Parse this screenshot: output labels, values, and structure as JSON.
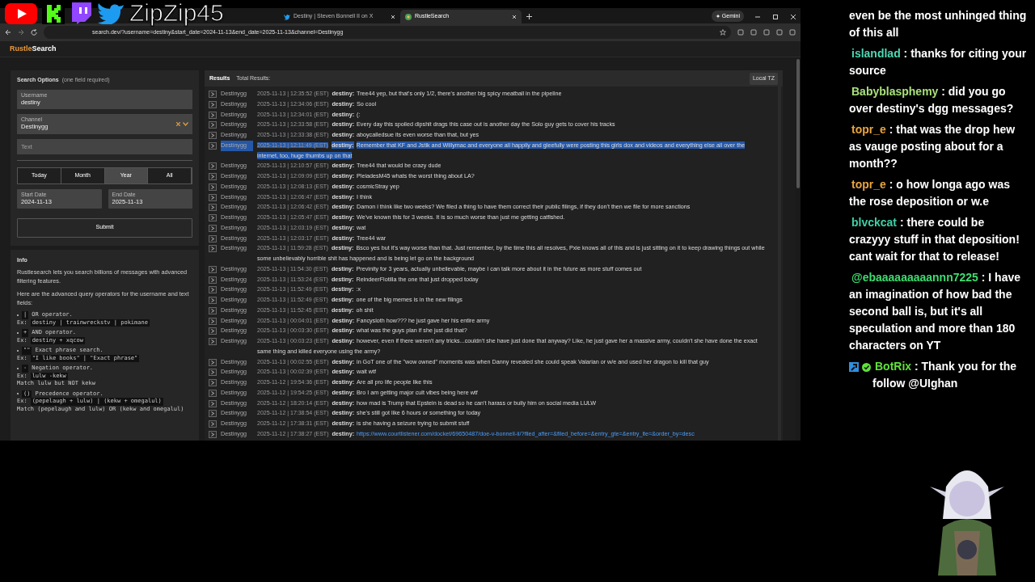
{
  "overlay": {
    "channel_name": "ZipZip45"
  },
  "browser": {
    "tabs": [
      {
        "title": "Destiny | Steven Bonnell II on X",
        "selected": false,
        "kind": "x"
      },
      {
        "title": "RustleSearch",
        "selected": true,
        "kind": "site"
      }
    ],
    "gemini_label": "Gemini",
    "url": "search.dev/?username=destiny&start_date=2024-11-13&end_date=2025-11-13&channel=Destinygg"
  },
  "site": {
    "logo_accent": "Rustle",
    "logo_rest": "Search"
  },
  "search_options": {
    "title": "Search Options",
    "hint": "(one field required)",
    "username": {
      "label": "Username",
      "value": "destiny"
    },
    "channel": {
      "label": "Channel",
      "value": "Destinygg"
    },
    "text": {
      "placeholder": "Text"
    },
    "ranges": [
      {
        "label": "Today",
        "selected": false
      },
      {
        "label": "Month",
        "selected": false
      },
      {
        "label": "Year",
        "selected": true
      },
      {
        "label": "All",
        "selected": false
      }
    ],
    "start_date": {
      "label": "Start Date",
      "value": "2024-11-13"
    },
    "end_date": {
      "label": "End Date",
      "value": "2025-11-13"
    },
    "submit": "Submit"
  },
  "info": {
    "title": "Info",
    "paragraphs": [
      "Rustlesearch lets you search billions of messages with advanced filtering features.",
      "Here are the advanced query operators for the username and text fields:"
    ],
    "operators": [
      {
        "op": "|",
        "desc": "OR operator.",
        "ex_label": "Ex:",
        "example": "destiny | trainwreckstv | pokimane"
      },
      {
        "op": "+",
        "desc": "AND operator.",
        "ex_label": "Ex:",
        "example": "destiny + xqcow"
      },
      {
        "op": "\"\"",
        "desc": "Exact phrase search.",
        "ex_label": "Ex:",
        "example": "\"I like books\" | \"Exact phrase\""
      },
      {
        "op": "-",
        "desc": "Negation operator.",
        "ex_label": "Ex:",
        "example": "lulw -kekw",
        "note": "Match lulw but NOT kekw"
      },
      {
        "op": "()",
        "desc": "Precedence operator.",
        "ex_label": "Ex:",
        "example": "(pepelaugh + lulw) | (kekw + omegalul)",
        "note": "Match (pepelaugh and lulw) OR (kekw and omegalul)"
      }
    ]
  },
  "results": {
    "title": "Results",
    "total_label": "Total Results:",
    "tz_button": "Local TZ",
    "rows": [
      {
        "channel": "Destinygg",
        "time": "2025-11-13 | 12:35:52 (EST)",
        "user": "destiny:",
        "message": "Tree44 yep, but that's only 1/2, there's another big spicy meatball in the pipeline",
        "kind": "text",
        "highlighted": false
      },
      {
        "channel": "Destinygg",
        "time": "2025-11-13 | 12:34:06 (EST)",
        "user": "destiny:",
        "message": "So cool",
        "kind": "text",
        "highlighted": false
      },
      {
        "channel": "Destinygg",
        "time": "2025-11-13 | 12:34:01 (EST)",
        "user": "destiny:",
        "message": "(:",
        "kind": "text",
        "highlighted": false
      },
      {
        "channel": "Destinygg",
        "time": "2025-11-13 | 12:33:58 (EST)",
        "user": "destiny:",
        "message": "Every day this spoiled dipshit drags this case out is another day the Solo guy gets to cover his tracks",
        "kind": "text",
        "highlighted": false
      },
      {
        "channel": "Destinygg",
        "time": "2025-11-13 | 12:33:38 (EST)",
        "user": "destiny:",
        "message": "aboycalledsue its even worse than that, but yes",
        "kind": "text",
        "highlighted": false
      },
      {
        "channel": "Destinygg",
        "time": "2025-11-13 | 12:11:49 (EST)",
        "user": "destiny:",
        "message": "Remember that KF and Jstik and Willymac and everyone all happily and gleefully were posting this girls dox and videos and everything else all over the internet, too, huge thumbs up on that",
        "kind": "text",
        "highlighted": true
      },
      {
        "channel": "Destinygg",
        "time": "2025-11-13 | 12:10:57 (EST)",
        "user": "destiny:",
        "message": "Tree44 that would be crazy dude",
        "kind": "text",
        "highlighted": false
      },
      {
        "channel": "Destinygg",
        "time": "2025-11-13 | 12:09:09 (EST)",
        "user": "destiny:",
        "message": "PleiadesM45 whats the worst thing about LA?",
        "kind": "text",
        "highlighted": false
      },
      {
        "channel": "Destinygg",
        "time": "2025-11-13 | 12:08:13 (EST)",
        "user": "destiny:",
        "message": "cosmicStray yep",
        "kind": "text",
        "highlighted": false
      },
      {
        "channel": "Destinygg",
        "time": "2025-11-13 | 12:06:47 (EST)",
        "user": "destiny:",
        "message": "I think",
        "kind": "text",
        "highlighted": false
      },
      {
        "channel": "Destinygg",
        "time": "2025-11-13 | 12:06:42 (EST)",
        "user": "destiny:",
        "message": "Damon i think like two weeks? We filed a thing to have them correct their public filings, if they don't then we file for more sanctions",
        "kind": "text",
        "highlighted": false
      },
      {
        "channel": "Destinygg",
        "time": "2025-11-13 | 12:05:47 (EST)",
        "user": "destiny:",
        "message": "We've known this for 3 weeks. It is so much worse than just me getting catfished.",
        "kind": "text",
        "highlighted": false
      },
      {
        "channel": "Destinygg",
        "time": "2025-11-13 | 12:03:19 (EST)",
        "user": "destiny:",
        "message": "wat",
        "kind": "text",
        "highlighted": false
      },
      {
        "channel": "Destinygg",
        "time": "2025-11-13 | 12:03:17 (EST)",
        "user": "destiny:",
        "message": "Tree44 war",
        "kind": "text",
        "highlighted": false
      },
      {
        "channel": "Destinygg",
        "time": "2025-11-13 | 11:59:28 (EST)",
        "user": "destiny:",
        "message": "Bsco yes but it's way worse than that. Just remember, by the time this all resolves, Pxie knows all of this and is just sitting on it to keep drawing things out while some unbelievably horrible shit has happened and is being let go on the background",
        "kind": "text",
        "highlighted": false
      },
      {
        "channel": "Destinygg",
        "time": "2025-11-13 | 11:54:30 (EST)",
        "user": "destiny:",
        "message": "Previnity for 3 years, actually unbelievable, maybe I can talk more about it in the future as more stuff comes out",
        "kind": "text",
        "highlighted": false
      },
      {
        "channel": "Destinygg",
        "time": "2025-11-13 | 11:53:24 (EST)",
        "user": "destiny:",
        "message": "ReindeerFlotilla the one that just dropped today",
        "kind": "text",
        "highlighted": false
      },
      {
        "channel": "Destinygg",
        "time": "2025-11-13 | 11:52:49 (EST)",
        "user": "destiny:",
        "message": ":x",
        "kind": "text",
        "highlighted": false
      },
      {
        "channel": "Destinygg",
        "time": "2025-11-13 | 11:52:49 (EST)",
        "user": "destiny:",
        "message": "one of the big memes is in the new filings",
        "kind": "text",
        "highlighted": false
      },
      {
        "channel": "Destinygg",
        "time": "2025-11-13 | 11:52:45 (EST)",
        "user": "destiny:",
        "message": "oh shit",
        "kind": "text",
        "highlighted": false
      },
      {
        "channel": "Destinygg",
        "time": "2025-11-13 | 00:04:01 (EST)",
        "user": "destiny:",
        "message": "Fancysloth how??? he just gave her his entire army",
        "kind": "text",
        "highlighted": false
      },
      {
        "channel": "Destinygg",
        "time": "2025-11-13 | 00:03:30 (EST)",
        "user": "destiny:",
        "message": "what was the guys plan if she just did that?",
        "kind": "text",
        "highlighted": false
      },
      {
        "channel": "Destinygg",
        "time": "2025-11-13 | 00:03:23 (EST)",
        "user": "destiny:",
        "message": "however, even if there weren't any tricks...couldn't she have just done that anyway? Like, he just gave her a massive army, couldn't she have done the exact same thing and killed everyone using the army?",
        "kind": "text",
        "highlighted": false
      },
      {
        "channel": "Destinygg",
        "time": "2025-11-13 | 00:02:55 (EST)",
        "user": "destiny:",
        "message": "in GoT one of the \"wow owned\" moments was when Danny revealed she could speak Valarian or w/e and used her dragon to kill that guy",
        "kind": "text",
        "highlighted": false
      },
      {
        "channel": "Destinygg",
        "time": "2025-11-13 | 00:02:39 (EST)",
        "user": "destiny:",
        "message": "wait wtf",
        "kind": "text",
        "highlighted": false
      },
      {
        "channel": "Destinygg",
        "time": "2025-11-12 | 19:54:36 (EST)",
        "user": "destiny:",
        "message": "Are all pro life people like this",
        "kind": "text",
        "highlighted": false
      },
      {
        "channel": "Destinygg",
        "time": "2025-11-12 | 19:54:25 (EST)",
        "user": "destiny:",
        "message": "Bro I am getting major cult vibes being here wtf",
        "kind": "text",
        "highlighted": false
      },
      {
        "channel": "Destinygg",
        "time": "2025-11-12 | 18:20:14 (EST)",
        "user": "destiny:",
        "message": "how mad is Trump that Epstein is dead so he can't harass or bully him on social media LULW",
        "kind": "text",
        "highlighted": false
      },
      {
        "channel": "Destinygg",
        "time": "2025-11-12 | 17:38:54 (EST)",
        "user": "destiny:",
        "message": "she's still got like 6 hours or something for today",
        "kind": "text",
        "highlighted": false
      },
      {
        "channel": "Destinygg",
        "time": "2025-11-12 | 17:38:31 (EST)",
        "user": "destiny:",
        "message": "is she having a seizure trying to submit stuff",
        "kind": "text",
        "highlighted": false
      },
      {
        "channel": "Destinygg",
        "time": "2025-11-12 | 17:38:27 (EST)",
        "user": "destiny:",
        "message": "https://www.courtlistener.com/docket/69650487/doe-v-bonnell-ii/?filed_after=&filed_before=&entry_gte=&entry_lte=&order_by=desc",
        "kind": "link",
        "highlighted": false
      }
    ]
  },
  "chat": [
    {
      "text": "even be the most unhinged thing of this all"
    },
    {
      "user": "islandlad",
      "color": "#4fd6b4",
      "text": ": thanks for citing your source"
    },
    {
      "user": "Babyblasphemy",
      "color": "#a8e07a",
      "text": ": did you go over destiny's dgg messages?"
    },
    {
      "user": "topr_e",
      "color": "#e8a340",
      "text": ": that was the drop hew as vauge posting about for a month??"
    },
    {
      "user": "topr_e",
      "color": "#e8a340",
      "text": ": o how longa ago was the rose deposition or w.e"
    },
    {
      "user": "blvckcat",
      "color": "#3fcfa4",
      "text": ": there could be crazyyy stuff in that deposition! cant wait for that to release!"
    },
    {
      "user": "@ebaaaaaaaaannn7225",
      "color": "#3ddc70",
      "text": ": I have an imagination of how bad the second ball is, but it's all speculation and more than 180 characters on YT"
    },
    {
      "user": "BotRix",
      "color": "#5fe03a",
      "text": ": Thank you for the follow @UIghan",
      "badges": true
    }
  ]
}
